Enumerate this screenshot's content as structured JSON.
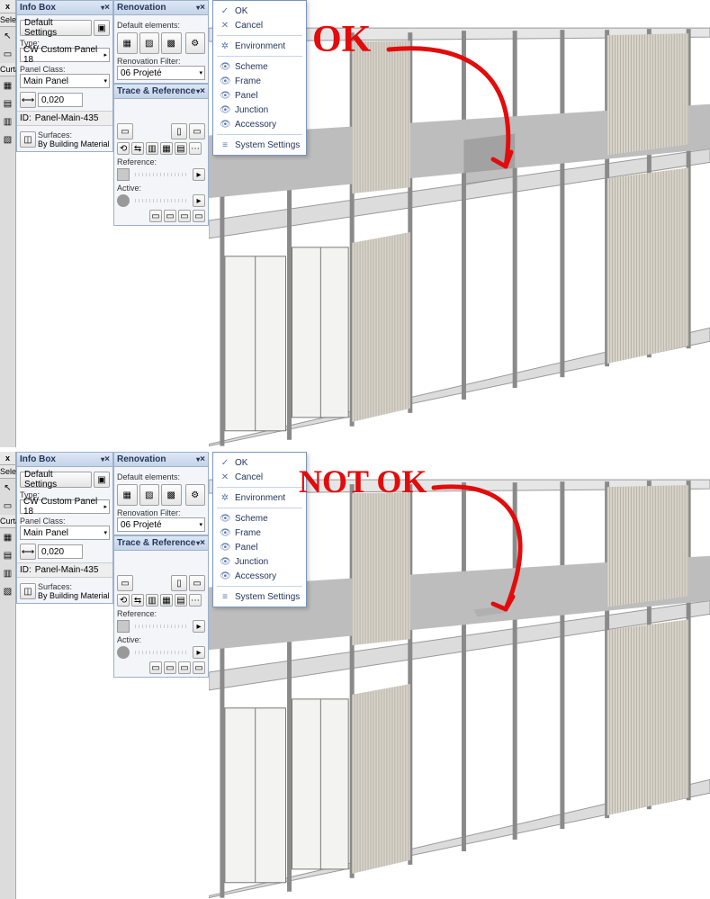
{
  "top": {
    "strip": {
      "close": "x",
      "sel": "Selec",
      "arrow": "↖",
      "cz": "Curta"
    },
    "info": {
      "title": "Info Box",
      "defaults_btn": "Default Settings",
      "type_lbl": "Type:",
      "type": "CW Custom Panel 18",
      "class_lbl": "Panel Class:",
      "class": "Main Panel",
      "thickness": "0,020",
      "id_lbl": "ID:",
      "id": "Panel-Main-435",
      "surf_lbl": "Surfaces:",
      "surf": "By Building Material"
    },
    "reno": {
      "title": "Renovation",
      "def_lbl": "Default elements:",
      "filter_lbl": "Renovation Filter:",
      "filter": "06 Projeté"
    },
    "trace": {
      "title": "Trace & Reference",
      "ref": "Reference:",
      "act": "Active:"
    },
    "menu": {
      "ok": "OK",
      "cancel": "Cancel",
      "env": "Environment",
      "scheme": "Scheme",
      "frame": "Frame",
      "panel": "Panel",
      "junction": "Junction",
      "accessory": "Accessory",
      "sys": "System Settings"
    },
    "annot": "OK"
  },
  "bot": {
    "strip": {
      "close": "x",
      "sel": "Selec",
      "arrow": "↖",
      "cz": "Curta"
    },
    "info": {
      "title": "Info Box",
      "defaults_btn": "Default Settings",
      "type_lbl": "Type:",
      "type": "CW Custom Panel 18",
      "class_lbl": "Panel Class:",
      "class": "Main Panel",
      "thickness": "0,020",
      "id_lbl": "ID:",
      "id": "Panel-Main-435",
      "surf_lbl": "Surfaces:",
      "surf": "By Building Material"
    },
    "reno": {
      "title": "Renovation",
      "def_lbl": "Default elements:",
      "filter_lbl": "Renovation Filter:",
      "filter": "06 Projeté"
    },
    "trace": {
      "title": "Trace & Reference",
      "ref": "Reference:",
      "act": "Active:"
    },
    "menu": {
      "ok": "OK",
      "cancel": "Cancel",
      "env": "Environment",
      "scheme": "Scheme",
      "frame": "Frame",
      "panel": "Panel",
      "junction": "Junction",
      "accessory": "Accessory",
      "sys": "System Settings"
    },
    "annot": "NOT OK"
  }
}
